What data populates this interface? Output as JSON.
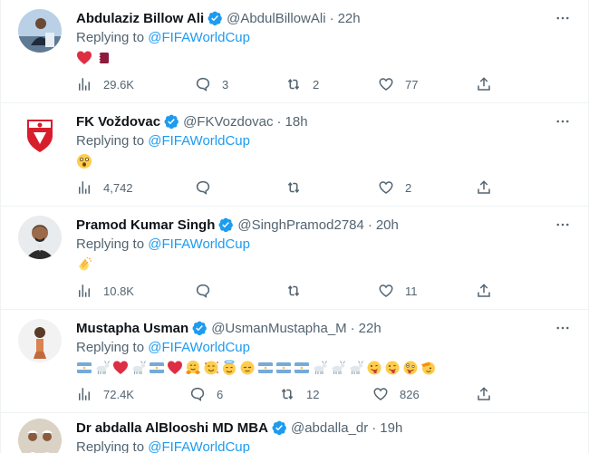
{
  "replying_to_text": "Replying to",
  "tweets": [
    {
      "display_name": "Abdulaziz Billow Ali",
      "handle": "@AbdulBillowAli",
      "time": "22h",
      "mention": "@FIFAWorldCup",
      "content_emojis": [
        "red-heart",
        "qatar-flag"
      ],
      "stats": {
        "views": "29.6K",
        "replies": "3",
        "retweets": "2",
        "likes": "77"
      }
    },
    {
      "display_name": "FK Voždovac",
      "handle": "@FKVozdovac",
      "time": "18h",
      "mention": "@FIFAWorldCup",
      "content_emojis": [
        "astonished-face"
      ],
      "stats": {
        "views": "4,742",
        "replies": "",
        "retweets": "",
        "likes": "2"
      }
    },
    {
      "display_name": "Pramod Kumar Singh",
      "handle": "@SinghPramod2784",
      "time": "20h",
      "mention": "@FIFAWorldCup",
      "content_emojis": [
        "clapping-hands"
      ],
      "stats": {
        "views": "10.8K",
        "replies": "",
        "retweets": "",
        "likes": "11"
      }
    },
    {
      "display_name": "Mustapha Usman",
      "handle": "@UsmanMustapha_M",
      "time": "22h",
      "mention": "@FIFAWorldCup",
      "content_emojis": [
        "argentina-flag",
        "goat",
        "red-heart",
        "goat",
        "argentina-flag",
        "red-heart",
        "hugging-face",
        "smiling-hearts",
        "smiling-halo",
        "relieved-face",
        "argentina-flag",
        "argentina-flag",
        "argentina-flag",
        "goat",
        "goat",
        "goat",
        "winking-tongue",
        "winking-tongue",
        "zany-face",
        "saluting-face"
      ],
      "stats": {
        "views": "72.4K",
        "replies": "6",
        "retweets": "12",
        "likes": "826"
      }
    },
    {
      "display_name": "Dr abdalla AlBlooshi MD MBA",
      "handle": "@abdalla_dr",
      "time": "19h",
      "mention": "@FIFAWorldCup",
      "content_emojis": [],
      "stats": {
        "views": "",
        "replies": "",
        "retweets": "",
        "likes": ""
      }
    }
  ],
  "colors": {
    "accent": "#1d9bf0",
    "muted": "#536471",
    "text": "#0f1419",
    "divider": "#eff3f4"
  }
}
